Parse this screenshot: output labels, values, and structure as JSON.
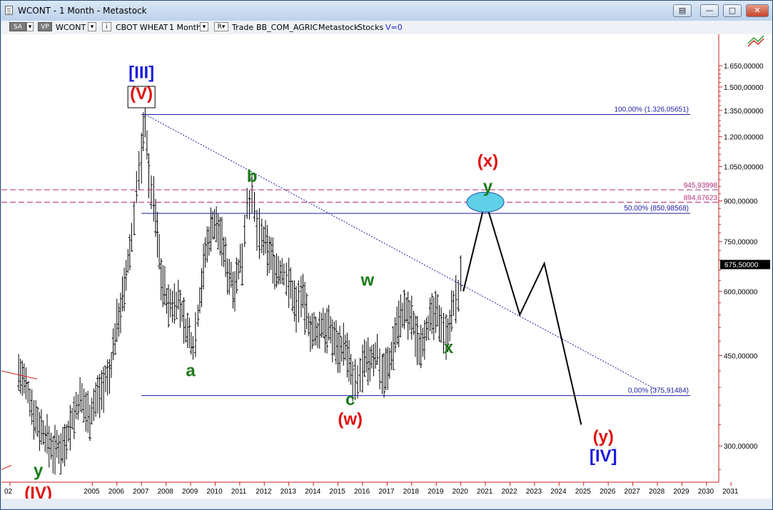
{
  "window": {
    "title": "WCONT - 1 Month - Metastock"
  },
  "toolbar": {
    "sa": "SA",
    "vp": "VP",
    "symbol": "WCONT",
    "name": "CBOT WHEAT",
    "period": "1 Month",
    "r": "R",
    "trade": "Trade",
    "source": "BB_COM_AGRIC",
    "app": "Metastock",
    "type": "Stocks",
    "v": "V=0"
  },
  "chart_data": {
    "type": "candlestick",
    "x_ticks": [
      "02",
      "2005",
      "2006",
      "2007",
      "2008",
      "2009",
      "2010",
      "2011",
      "2012",
      "2013",
      "2014",
      "2015",
      "2016",
      "2017",
      "2018",
      "2019",
      "2020",
      "2021",
      "2022",
      "2023",
      "2024",
      "2025",
      "2026",
      "2027",
      "2028",
      "2029",
      "2030",
      "2031"
    ],
    "y_scale": "log",
    "y_ticks": [
      "1.650,00000",
      "1.500,00000",
      "1.350,00000",
      "1.200,00000",
      "1.050,00000",
      "900,00000",
      "750,00000",
      "600,00000",
      "450,00000",
      "300,00000"
    ],
    "y_tick_values": [
      1650,
      1500,
      1350,
      1200,
      1050,
      900,
      750,
      600,
      450,
      300
    ],
    "last_price_label": "675,50000",
    "last_price": 675.5,
    "price_path": [
      [
        2003.0,
        420
      ],
      [
        2003.3,
        390
      ],
      [
        2003.7,
        340
      ],
      [
        2004.0,
        320
      ],
      [
        2004.4,
        295
      ],
      [
        2004.8,
        300
      ],
      [
        2005.1,
        330
      ],
      [
        2005.5,
        370
      ],
      [
        2005.9,
        345
      ],
      [
        2006.3,
        385
      ],
      [
        2006.7,
        410
      ],
      [
        2007.0,
        520
      ],
      [
        2007.3,
        600
      ],
      [
        2007.6,
        760
      ],
      [
        2007.8,
        950
      ],
      [
        2008.0,
        1100
      ],
      [
        2008.15,
        1326
      ],
      [
        2008.3,
        1000
      ],
      [
        2008.5,
        900
      ],
      [
        2008.8,
        650
      ],
      [
        2009.1,
        560
      ],
      [
        2009.5,
        580
      ],
      [
        2009.8,
        510
      ],
      [
        2010.1,
        470
      ],
      [
        2010.3,
        540
      ],
      [
        2010.6,
        710
      ],
      [
        2010.9,
        820
      ],
      [
        2011.2,
        780
      ],
      [
        2011.5,
        660
      ],
      [
        2011.8,
        620
      ],
      [
        2012.1,
        700
      ],
      [
        2012.3,
        900
      ],
      [
        2012.5,
        910
      ],
      [
        2012.7,
        800
      ],
      [
        2012.9,
        760
      ],
      [
        2013.2,
        720
      ],
      [
        2013.5,
        660
      ],
      [
        2013.8,
        650
      ],
      [
        2014.0,
        630
      ],
      [
        2014.3,
        560
      ],
      [
        2014.5,
        600
      ],
      [
        2014.8,
        520
      ],
      [
        2015.1,
        490
      ],
      [
        2015.4,
        520
      ],
      [
        2015.7,
        500
      ],
      [
        2016.0,
        470
      ],
      [
        2016.3,
        470
      ],
      [
        2016.6,
        400
      ],
      [
        2016.8,
        395
      ],
      [
        2017.0,
        430
      ],
      [
        2017.3,
        440
      ],
      [
        2017.6,
        455
      ],
      [
        2017.8,
        420
      ],
      [
        2018.1,
        430
      ],
      [
        2018.4,
        520
      ],
      [
        2018.7,
        550
      ],
      [
        2019.0,
        530
      ],
      [
        2019.3,
        470
      ],
      [
        2019.6,
        510
      ],
      [
        2019.9,
        540
      ],
      [
        2020.2,
        530
      ],
      [
        2020.4,
        490
      ],
      [
        2020.7,
        560
      ],
      [
        2020.9,
        600
      ],
      [
        2021.1,
        675
      ]
    ],
    "projection": [
      [
        2021.1,
        600
      ],
      [
        2022.0,
        900
      ],
      [
        2023.4,
        540
      ],
      [
        2024.4,
        680
      ],
      [
        2025.9,
        330
      ]
    ],
    "fib_levels": [
      {
        "label": "100,00% (1.326,05651)",
        "value": 1326.05651
      },
      {
        "label": "50,00% (850,98568)",
        "value": 850.98568
      },
      {
        "label": "0,00% (375,91484)",
        "value": 375.91484
      }
    ],
    "dashed_levels": [
      {
        "label": "945,93998",
        "value": 945.93998
      },
      {
        "label": "894,67623",
        "value": 894.67623
      }
    ],
    "trendline": [
      [
        2008.15,
        1326
      ],
      [
        2029.0,
        385
      ]
    ],
    "wave_labels": [
      {
        "text": "[III]",
        "color": "#1a1adc",
        "x": 2008.0,
        "y": 1560
      },
      {
        "text": "(V)",
        "color": "#e01010",
        "x": 2008.0,
        "y": 1420,
        "boxed": true
      },
      {
        "text": "b",
        "color": "#1a7a1a",
        "x": 2012.5,
        "y": 980
      },
      {
        "text": "a",
        "color": "#1a7a1a",
        "x": 2010.0,
        "y": 410
      },
      {
        "text": "w",
        "color": "#1a7a1a",
        "x": 2017.2,
        "y": 615
      },
      {
        "text": "c",
        "color": "#1a7a1a",
        "x": 2016.5,
        "y": 360
      },
      {
        "text": "(w)",
        "color": "#e01010",
        "x": 2016.5,
        "y": 330
      },
      {
        "text": "x",
        "color": "#1a7a1a",
        "x": 2020.5,
        "y": 455
      },
      {
        "text": "(x)",
        "color": "#e01010",
        "x": 2022.1,
        "y": 1050
      },
      {
        "text": "y",
        "color": "#1a7a1a",
        "x": 2022.1,
        "y": 935
      },
      {
        "text": "(y)",
        "color": "#e01010",
        "x": 2026.8,
        "y": 305
      },
      {
        "text": "[IV]",
        "color": "#1a1adc",
        "x": 2026.8,
        "y": 280
      },
      {
        "text": "y",
        "color": "#1a7a1a",
        "x": 2003.8,
        "y": 262
      },
      {
        "text": "(IV)",
        "color": "#e01010",
        "x": 2003.8,
        "y": 237
      }
    ],
    "highlight_ellipse": {
      "x": 2022.0,
      "y": 895
    },
    "colors": {
      "fib": "#1c1ca0",
      "dashed": "#b0307a",
      "bars": "#000000",
      "projection": "#000000",
      "ellipse": "#5fd0e8",
      "axis": "#cc2020"
    }
  }
}
